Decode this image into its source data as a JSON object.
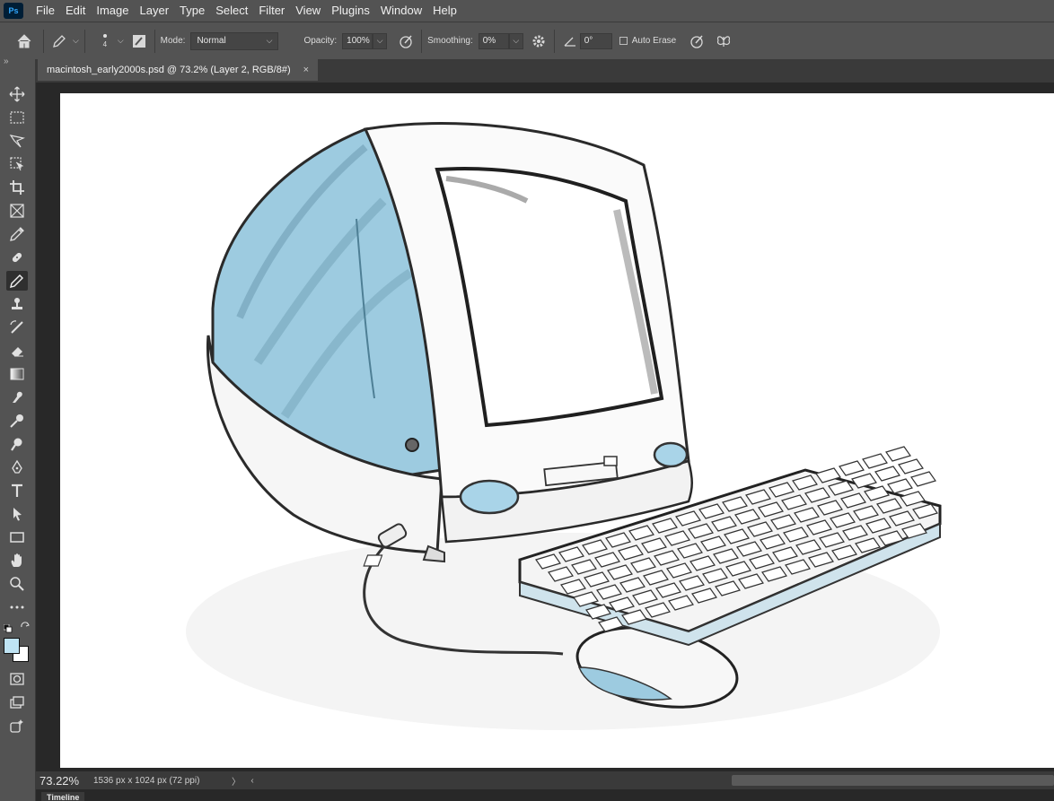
{
  "app": {
    "logo": "Ps"
  },
  "menubar": {
    "items": [
      "File",
      "Edit",
      "Image",
      "Layer",
      "Type",
      "Select",
      "Filter",
      "View",
      "Plugins",
      "Window",
      "Help"
    ]
  },
  "options": {
    "brush_size": "4",
    "mode_label": "Mode:",
    "mode_value": "Normal",
    "opacity_label": "Opacity:",
    "opacity_value": "100%",
    "smoothing_label": "Smoothing:",
    "smoothing_value": "0%",
    "angle_value": "0°",
    "auto_erase_label": "Auto Erase",
    "auto_erase_checked": false
  },
  "document": {
    "tab_title": "macintosh_early2000s.psd @ 73.2% (Layer 2, RGB/8#)",
    "close_glyph": "×"
  },
  "panel_collapse": "»",
  "tools": [
    "move-tool",
    "marquee-tool",
    "lasso-tool",
    "object-select-tool",
    "crop-tool",
    "frame-tool",
    "eyedropper-tool",
    "healing-brush-tool",
    "pencil-tool",
    "clone-stamp-tool",
    "history-brush-tool",
    "eraser-tool",
    "gradient-tool",
    "smudge-tool",
    "dodge-tool",
    "burn-tool",
    "pen-tool",
    "type-tool",
    "path-select-tool",
    "rectangle-tool",
    "hand-tool",
    "zoom-tool",
    "edit-toolbar",
    "quick-mask",
    "screen-mode",
    "generative-fill"
  ],
  "colors": {
    "foreground": "#bfe3f3",
    "background": "#ffffff",
    "ui_dark": "#282828",
    "ui_mid": "#535353"
  },
  "status": {
    "zoom": "73.22%",
    "doc_info": "1536 px x 1024 px (72 ppi)",
    "arrow_right": "〉",
    "arrow_left": "‹"
  },
  "timeline": {
    "label": "Timeline"
  }
}
